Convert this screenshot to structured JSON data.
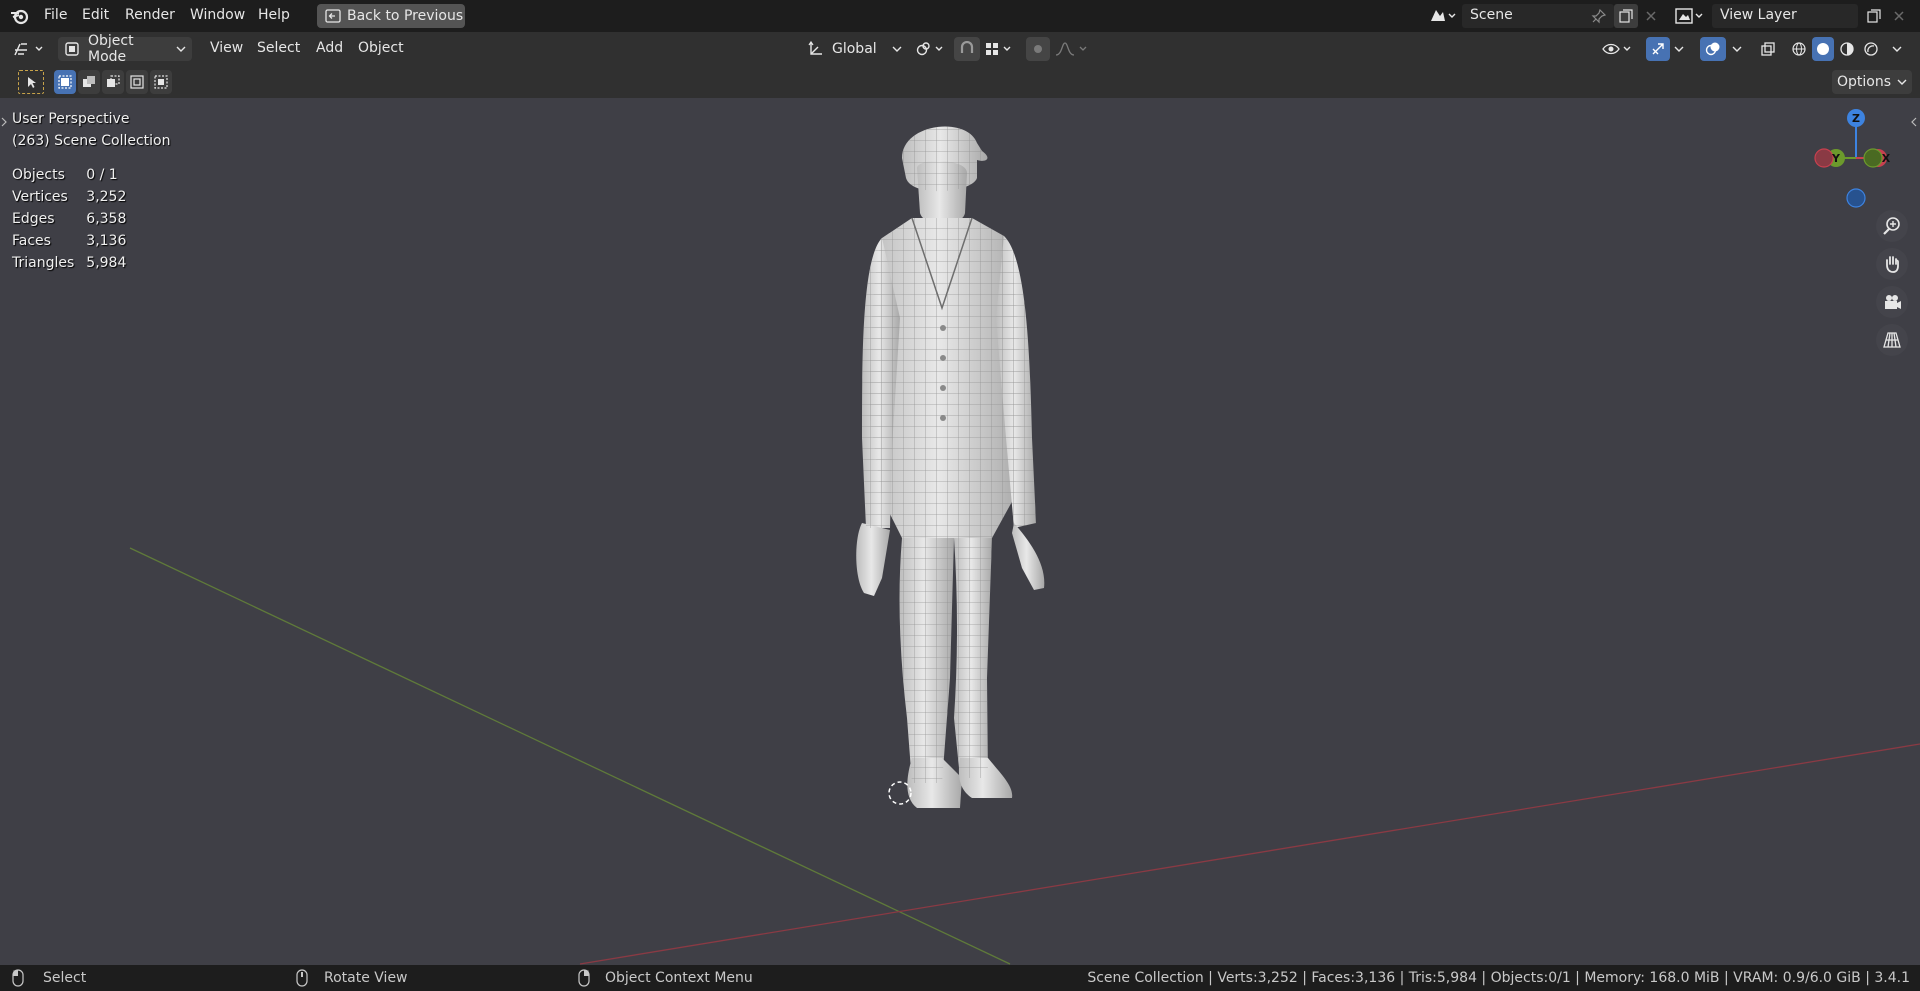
{
  "menubar": {
    "items": [
      "File",
      "Edit",
      "Render",
      "Window",
      "Help"
    ],
    "back_button": "Back to Previous",
    "scene": "Scene",
    "view_layer": "View Layer"
  },
  "header": {
    "mode": "Object Mode",
    "menus": [
      "View",
      "Select",
      "Add",
      "Object"
    ],
    "orientation": "Global"
  },
  "toolrow": {
    "options": "Options"
  },
  "viewport": {
    "perspective": "User Perspective",
    "collection": "(263) Scene Collection",
    "stats": [
      {
        "label": "Objects",
        "value": "0 / 1"
      },
      {
        "label": "Vertices",
        "value": "3,252"
      },
      {
        "label": "Edges",
        "value": "6,358"
      },
      {
        "label": "Faces",
        "value": "3,136"
      },
      {
        "label": "Triangles",
        "value": "5,984"
      }
    ],
    "gizmo": {
      "z": "Z",
      "y": "Y",
      "x": "X"
    }
  },
  "statusbar": {
    "select": "Select",
    "rotate": "Rotate View",
    "context": "Object Context Menu",
    "info": "Scene Collection | Verts:3,252 | Faces:3,136 | Tris:5,984 | Objects:0/1 | Memory: 168.0 MiB | VRAM: 0.9/6.0 GiB | 3.4.1"
  },
  "colors": {
    "viewport_bg": "#3f3f46",
    "accent": "#4772b3",
    "x_axis": "#c8404f",
    "y_axis": "#6c9a2c",
    "z_axis": "#3d83e0"
  }
}
